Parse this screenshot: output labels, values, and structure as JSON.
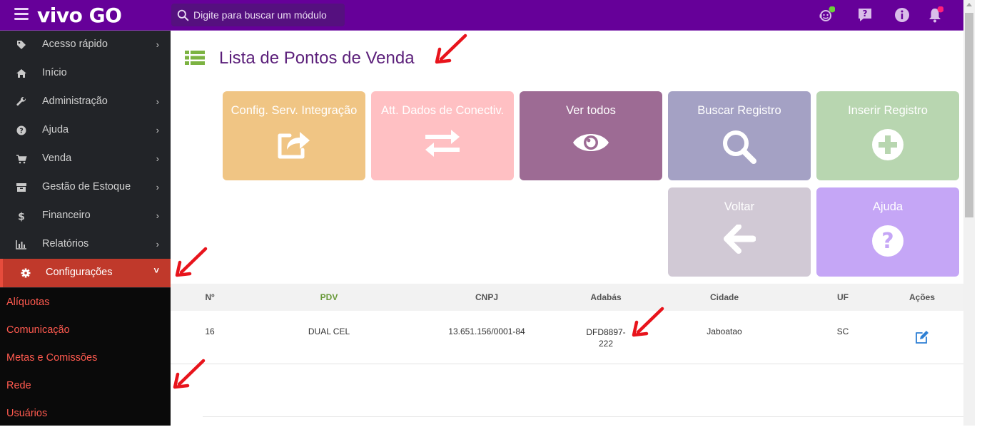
{
  "app": {
    "logo_text": "vivo GO"
  },
  "search": {
    "placeholder": "Digite para buscar um módulo"
  },
  "sidebar": {
    "items": [
      {
        "label": "Acesso rápido",
        "icon": "tag-icon",
        "chevron": "›"
      },
      {
        "label": "Início",
        "icon": "home-icon",
        "chevron": ""
      },
      {
        "label": "Administração",
        "icon": "wrench-icon",
        "chevron": "›"
      },
      {
        "label": "Ajuda",
        "icon": "question-circle-icon",
        "chevron": "›"
      },
      {
        "label": "Venda",
        "icon": "cart-icon",
        "chevron": "›"
      },
      {
        "label": "Gestão de Estoque",
        "icon": "archive-icon",
        "chevron": "›"
      },
      {
        "label": "Financeiro",
        "icon": "dollar-icon",
        "chevron": "›"
      },
      {
        "label": "Relatórios",
        "icon": "bar-chart-icon",
        "chevron": "›"
      },
      {
        "label": "Configurações",
        "icon": "gear-icon",
        "chevron": "˅",
        "active": true
      }
    ],
    "submenu": [
      "Alíquotas",
      "Comunicação",
      "Metas e Comissões",
      "Rede",
      "Usuários"
    ]
  },
  "page": {
    "title": "Lista de Pontos de Venda"
  },
  "tiles": [
    {
      "label": "Config. Serv. Integração",
      "icon": "share-icon",
      "color": "#f0c584"
    },
    {
      "label": "Att. Dados de Conectiv.",
      "icon": "exchange-icon",
      "color": "#ffc0c3"
    },
    {
      "label": "Ver todos",
      "icon": "eye-icon",
      "color": "#9d6b94"
    },
    {
      "label": "Buscar Registro",
      "icon": "search-icon",
      "color": "#a4a1c4"
    },
    {
      "label": "Inserir Registro",
      "icon": "plus-circle-icon",
      "color": "#b8d6b0"
    },
    {
      "label": "Voltar",
      "icon": "arrow-left-icon",
      "color": "#d1c9d5"
    },
    {
      "label": "Ajuda",
      "icon": "question-circle-icon",
      "color": "#c5a6f6"
    }
  ],
  "table": {
    "headers": [
      "Nº",
      "PDV",
      "CNPJ",
      "Adabás",
      "Cidade",
      "UF",
      "Ações"
    ],
    "rows": [
      {
        "numero": "16",
        "pdv": "DUAL CEL",
        "cnpj": "13.651.156/0001-84",
        "adabas_1": "DFD8897-",
        "adabas_2": "222",
        "cidade": "Jaboatao",
        "uf": "SC"
      }
    ]
  },
  "colors": {
    "brand": "#660099",
    "sidebar": "#222428",
    "active": "#c0392b",
    "submenu_text": "#ff5a4f",
    "pdv_header": "#6a9a3a",
    "annotation_arrow": "#e8141c"
  }
}
